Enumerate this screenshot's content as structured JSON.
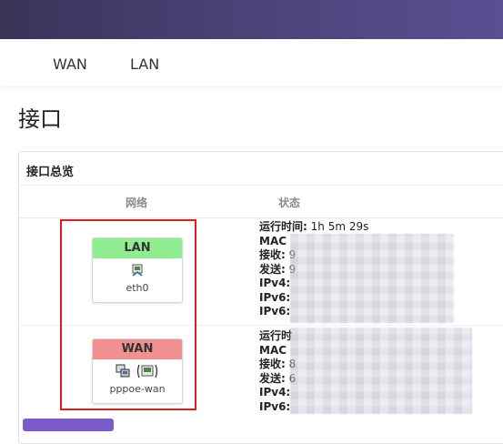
{
  "nav": {
    "tabs": [
      {
        "label": "WAN"
      },
      {
        "label": "LAN"
      }
    ]
  },
  "page": {
    "title": "接口"
  },
  "overview": {
    "title": "接口总览",
    "columns": {
      "network": "网络",
      "status": "状态"
    },
    "interfaces": [
      {
        "name": "LAN",
        "header_color": "#90ee90",
        "device": "eth0",
        "icons": [
          "ethernet-port-icon"
        ],
        "status": [
          {
            "key": "运行时间:",
            "value": "1h 5m 29s"
          },
          {
            "key": "MAC",
            "value": ""
          },
          {
            "key": "接收:",
            "value": "9"
          },
          {
            "key": "发送:",
            "value": "9"
          },
          {
            "key": "IPv4:",
            "value": ""
          },
          {
            "key": "IPv6:",
            "value": ""
          },
          {
            "key": "IPv6:",
            "value": ""
          }
        ]
      },
      {
        "name": "WAN",
        "header_color": "#f09090",
        "device": "pppoe-wan",
        "icons": [
          "bridge-icon",
          "pppoe-icon"
        ],
        "status": [
          {
            "key": "运行时",
            "value": ""
          },
          {
            "key": "MAC",
            "value": ""
          },
          {
            "key": "接收:",
            "value": "8"
          },
          {
            "key": "发送:",
            "value": "6"
          },
          {
            "key": "IPv4:",
            "value": ""
          },
          {
            "key": "IPv6:",
            "value": ""
          }
        ]
      }
    ]
  },
  "colors": {
    "topbar_start": "#3a3358",
    "topbar_end": "#5b4e93",
    "highlight_frame": "#d81e1e",
    "accent_button": "#7b5cc9"
  }
}
